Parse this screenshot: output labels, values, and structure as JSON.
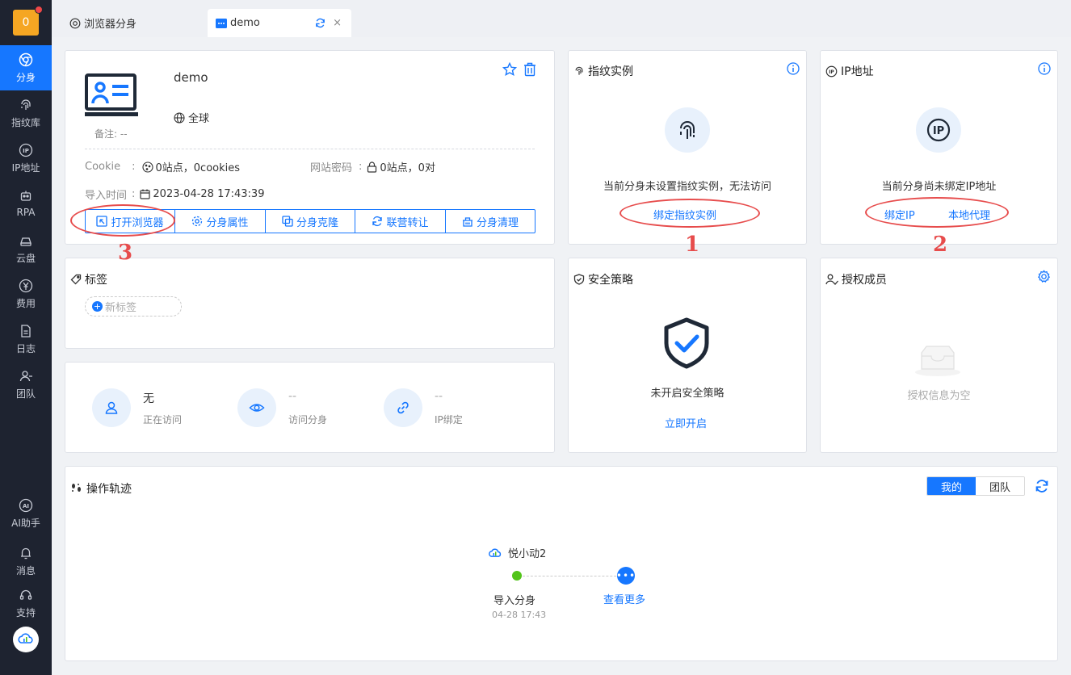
{
  "sidebar": {
    "badge": "0",
    "items": [
      {
        "label": "分身",
        "icon": "chrome-icon",
        "active": true
      },
      {
        "label": "指纹库",
        "icon": "fingerprint-icon"
      },
      {
        "label": "IP地址",
        "icon": "ip-icon"
      },
      {
        "label": "RPA",
        "icon": "robot-icon"
      },
      {
        "label": "云盘",
        "icon": "cloud-drive-icon"
      },
      {
        "label": "费用",
        "icon": "yen-icon"
      },
      {
        "label": "日志",
        "icon": "document-icon"
      },
      {
        "label": "团队",
        "icon": "team-icon"
      },
      {
        "label": "AI助手",
        "icon": "ai-icon"
      },
      {
        "label": "消息",
        "icon": "bell-icon"
      },
      {
        "label": "支持",
        "icon": "headset-icon"
      }
    ]
  },
  "tabs": [
    {
      "label": "浏览器分身"
    },
    {
      "label": "demo",
      "close": "×"
    }
  ],
  "profile": {
    "name": "demo",
    "region": "全球",
    "note": "备注: --",
    "cookie_label": "Cookie",
    "colon": ":",
    "cookie_value": "0站点，0cookies",
    "password_label": "网站密码",
    "password_value": "0站点，0对",
    "import_label": "导入时间",
    "import_value": "2023-04-28 17:43:39",
    "buttons": [
      "打开浏览器",
      "分身属性",
      "分身克隆",
      "联营转让",
      "分身清理"
    ]
  },
  "fingerprint": {
    "title": "指纹实例",
    "message": "当前分身未设置指纹实例，无法访问",
    "link": "绑定指纹实例"
  },
  "ip": {
    "title": "IP地址",
    "message": "当前分身尚未绑定IP地址",
    "link_bind": "绑定IP",
    "link_proxy": "本地代理"
  },
  "tags": {
    "title": "标签",
    "new_tag": "新标签",
    "plus": "+"
  },
  "stats": [
    {
      "value": "无",
      "label": "正在访问"
    },
    {
      "value": "--",
      "label": "访问分身"
    },
    {
      "value": "--",
      "label": "IP绑定"
    }
  ],
  "security": {
    "title": "安全策略",
    "message": "未开启安全策略",
    "link": "立即开启"
  },
  "members": {
    "title": "授权成员",
    "empty": "授权信息为空"
  },
  "trail": {
    "title": "操作轨迹",
    "toggle_mine": "我的",
    "toggle_team": "团队",
    "user": "悦小动2",
    "event": "导入分身",
    "time": "04-28 17:43",
    "more": "查看更多",
    "more_dots": "•••"
  },
  "annotations": [
    "1",
    "2",
    "3"
  ],
  "colors": {
    "accent": "#1677ff",
    "annotation": "#e74c4c",
    "sidebar": "#1e2330"
  }
}
